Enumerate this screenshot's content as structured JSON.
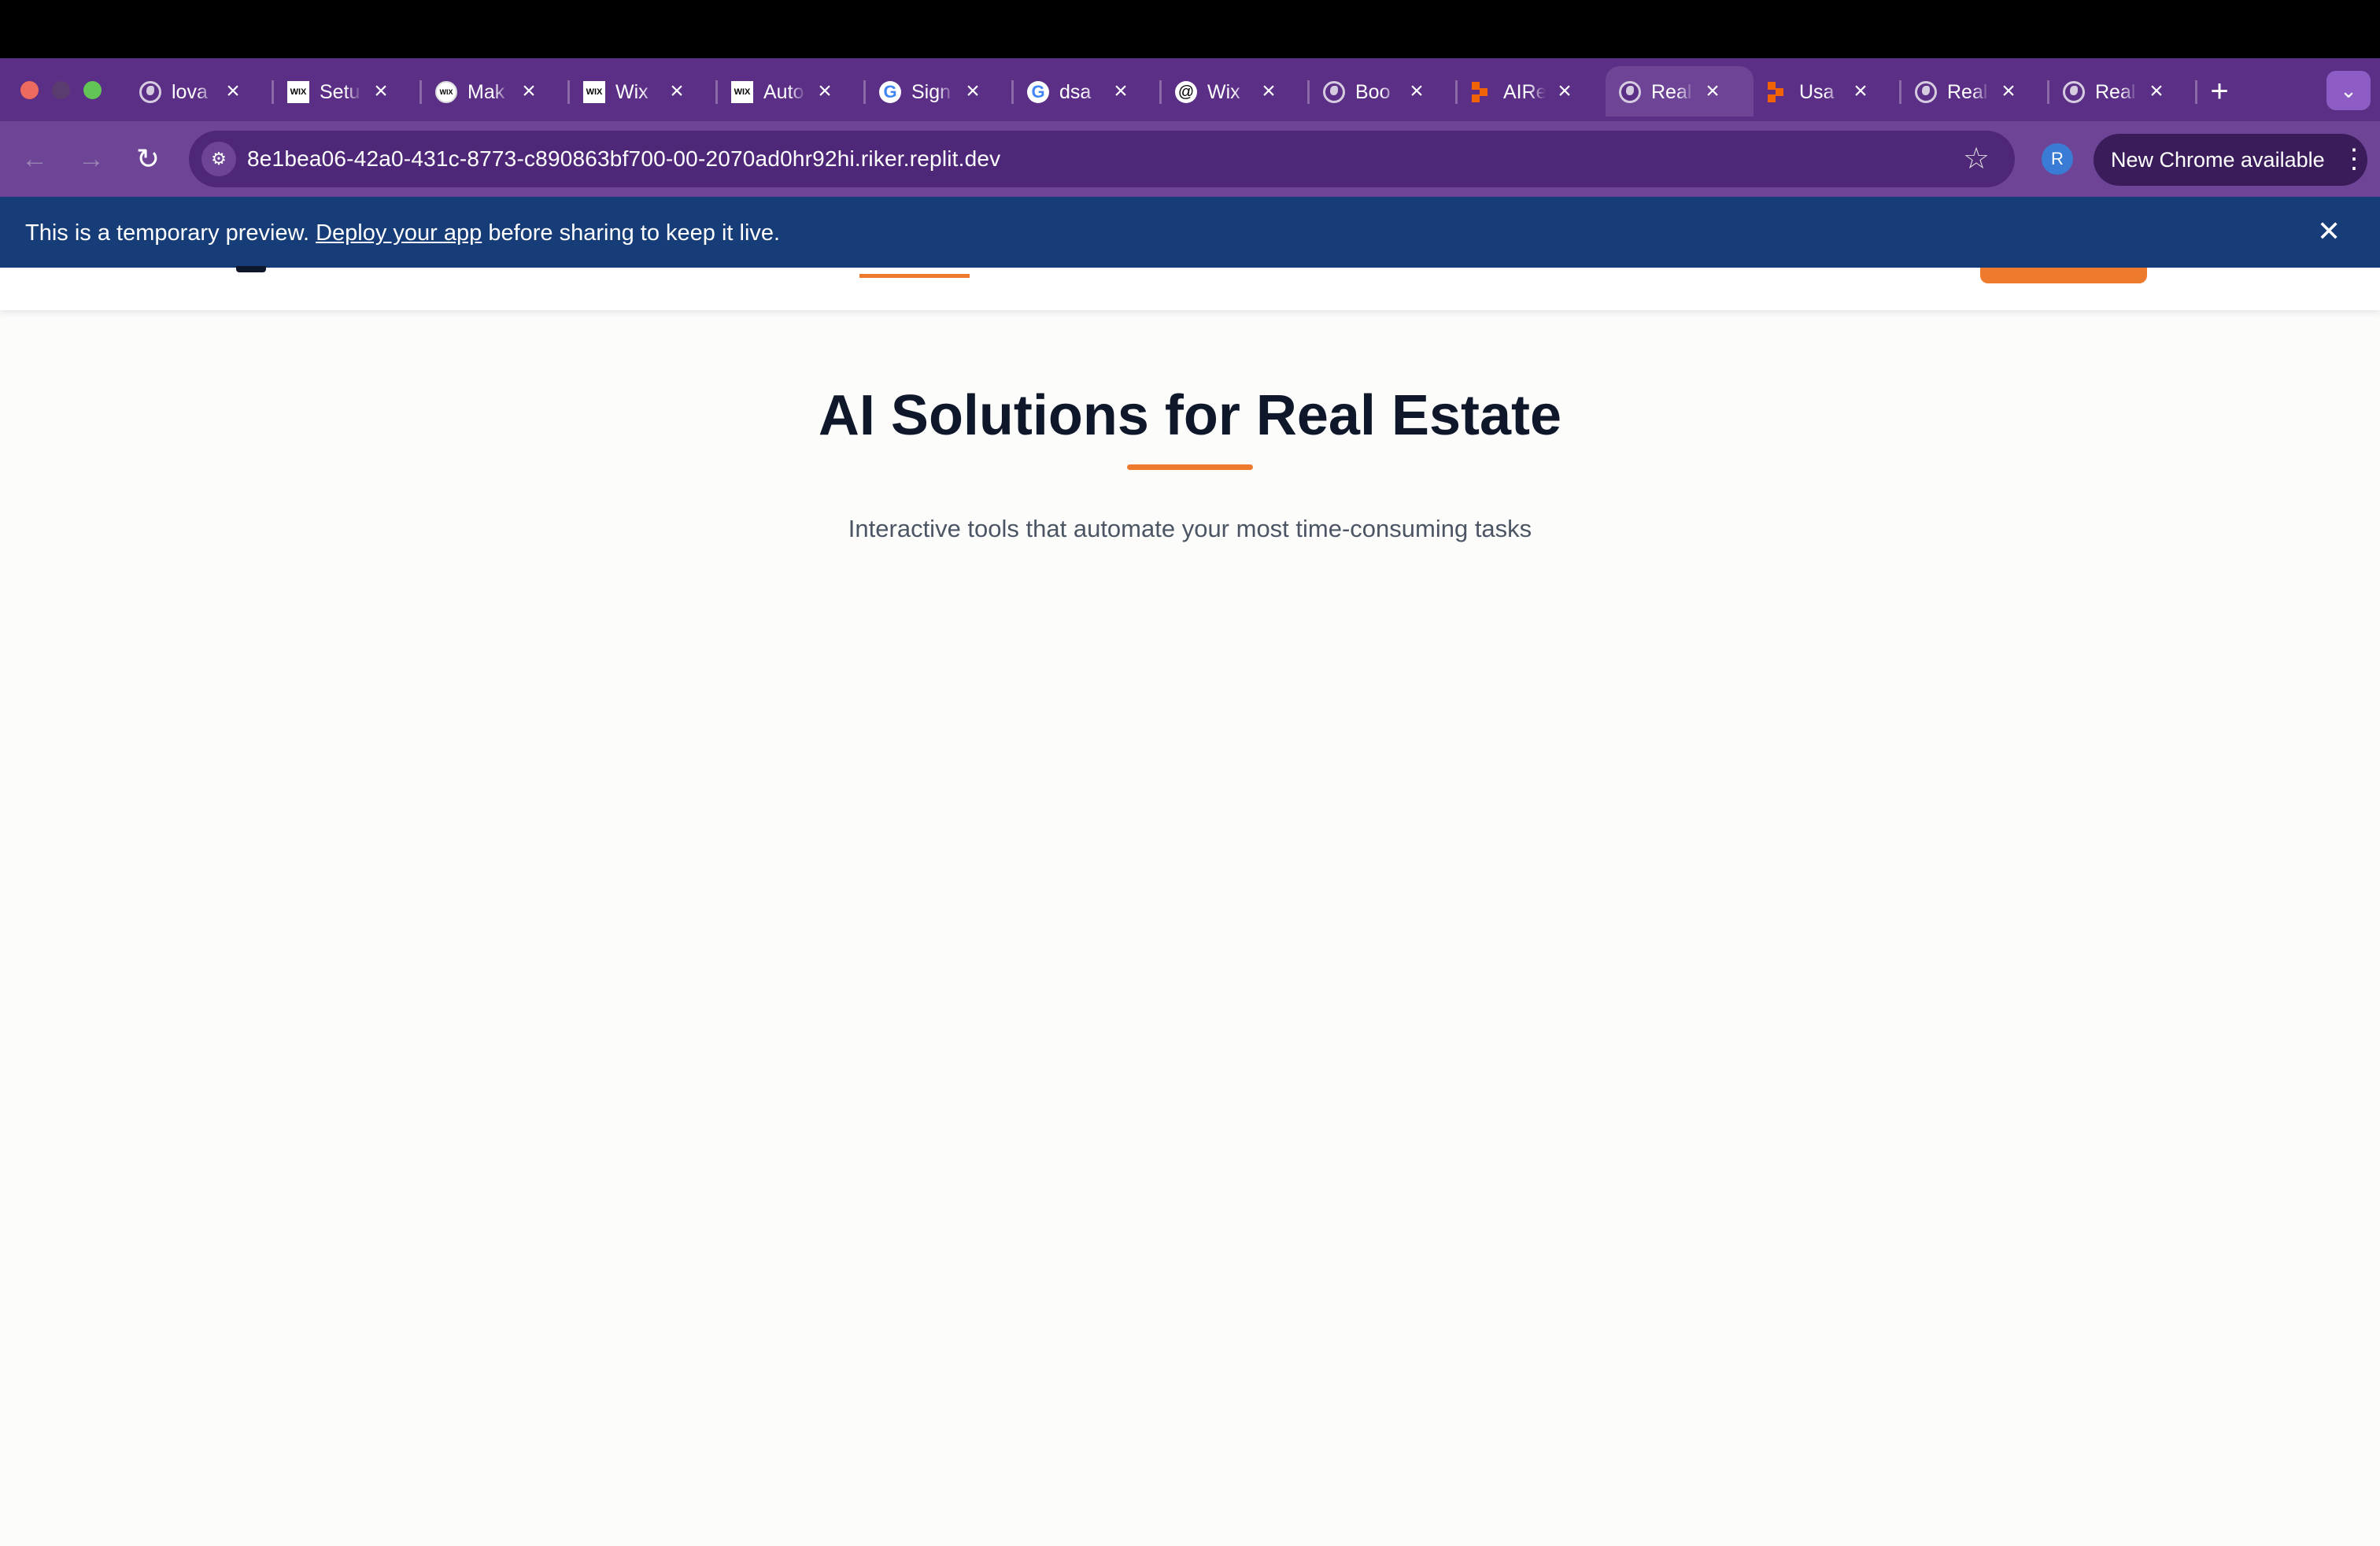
{
  "browser": {
    "tabs": [
      {
        "title": "lova",
        "favicon": "globe-icon"
      },
      {
        "title": "Setu",
        "favicon": "wix-icon"
      },
      {
        "title": "Mak",
        "favicon": "wix-circle-icon"
      },
      {
        "title": "Wix",
        "favicon": "wix-icon"
      },
      {
        "title": "Auto",
        "favicon": "wix-icon"
      },
      {
        "title": "Sign",
        "favicon": "google-icon"
      },
      {
        "title": "dsa",
        "favicon": "google-icon"
      },
      {
        "title": "Wix",
        "favicon": "spiral-icon"
      },
      {
        "title": "Boo",
        "favicon": "globe-icon"
      },
      {
        "title": "AIRe",
        "favicon": "replit-icon"
      },
      {
        "title": "Real",
        "favicon": "globe-icon",
        "active": true
      },
      {
        "title": "Usa",
        "favicon": "replit-icon"
      },
      {
        "title": "Real",
        "favicon": "globe-icon"
      },
      {
        "title": "Real",
        "favicon": "globe-icon"
      }
    ],
    "url": "8e1bea06-42a0-431c-8773-c890863bf700-00-2070ad0hr92hi.riker.replit.dev",
    "profile_initial": "R",
    "update_label": "New Chrome available",
    "colors": {
      "frame": "#5b2f86",
      "toolbar": "#6e4596",
      "omnibox": "#4f2778"
    }
  },
  "banner": {
    "text_before": "This is a temporary preview. ",
    "link": "Deploy your app",
    "text_after": " before sharing to keep it live.",
    "color": "#163d78"
  },
  "page": {
    "title": "AI Solutions for Real Estate",
    "subtitle": "Interactive tools that automate your most time-consuming tasks",
    "accent": "#ee7a2d",
    "heading_color": "#0f172a"
  }
}
